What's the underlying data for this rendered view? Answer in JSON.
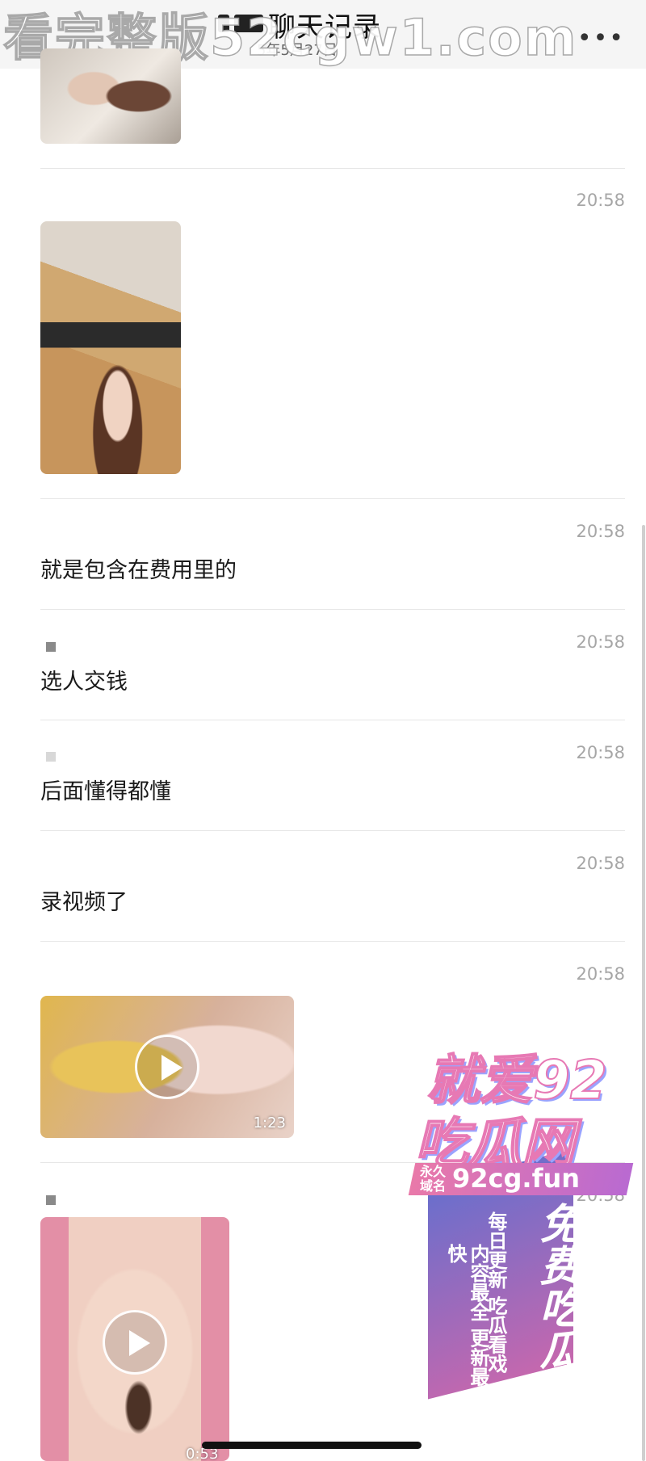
{
  "header": {
    "title": "聊天记录",
    "subtitle": "5年5月27日",
    "watermark": "看完整版52cgw1.com"
  },
  "messages": [
    {
      "time": "20:58",
      "type": "image"
    },
    {
      "time": "20:58",
      "type": "text",
      "text": "就是包含在费用里的"
    },
    {
      "time": "20:58",
      "type": "text",
      "text": "选人交钱"
    },
    {
      "time": "20:58",
      "type": "text",
      "text": "后面懂得都懂"
    },
    {
      "time": "20:58",
      "type": "text",
      "text": "录视频了"
    },
    {
      "time": "20:58",
      "type": "video",
      "duration": "1:23"
    },
    {
      "time": "20:58",
      "type": "video",
      "duration": "0:53"
    }
  ],
  "promo": {
    "line1": "就爱92",
    "line2": "吃瓜网",
    "permanent_label": "永久域名",
    "domain": "92cg.fun",
    "slogan_big": "免费吃瓜",
    "slogan_1": "每日更新 吃瓜看戏",
    "slogan_2": "内容最全 更新最快"
  },
  "icons": [
    "back-icon",
    "more-icon",
    "play-icon"
  ]
}
